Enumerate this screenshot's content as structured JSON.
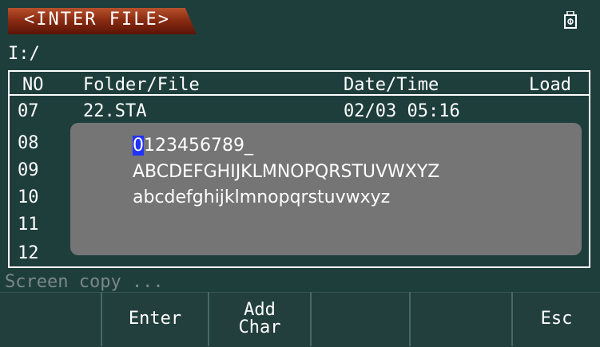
{
  "title": "<INTER FILE>",
  "usb_icon": "usb-drive-icon",
  "path": "I:/",
  "table": {
    "columns": [
      "NO",
      "Folder/File",
      "Date/Time",
      "Load"
    ],
    "rows": [
      {
        "no": "07",
        "name": "22.STA",
        "datetime": "02/03 05:16",
        "load": ""
      },
      {
        "no": "08",
        "name": "",
        "datetime": "",
        "load": ""
      },
      {
        "no": "09",
        "name": "",
        "datetime": "",
        "load": ""
      },
      {
        "no": "10",
        "name": "",
        "datetime": "",
        "load": ""
      },
      {
        "no": "11",
        "name": "",
        "datetime": "",
        "load": ""
      },
      {
        "no": "12",
        "name": "",
        "datetime": "",
        "load": ""
      }
    ]
  },
  "picker": {
    "selected_char": "0",
    "line1_rest": "123456789_",
    "line2": "ABCDEFGHIJKLMNOPQRSTUVWXYZ",
    "line3": "abcdefghijklmnopqrstuvwxyz"
  },
  "status": "Screen copy ...",
  "softkeys": [
    "",
    "Enter",
    "Add Char",
    "",
    "",
    "Esc"
  ],
  "colors": {
    "background": "#1e3e3c",
    "title_tab": "#8a2c12",
    "picker_bg": "#757575",
    "selection": "#2233ff",
    "status_text": "#7a8886"
  }
}
